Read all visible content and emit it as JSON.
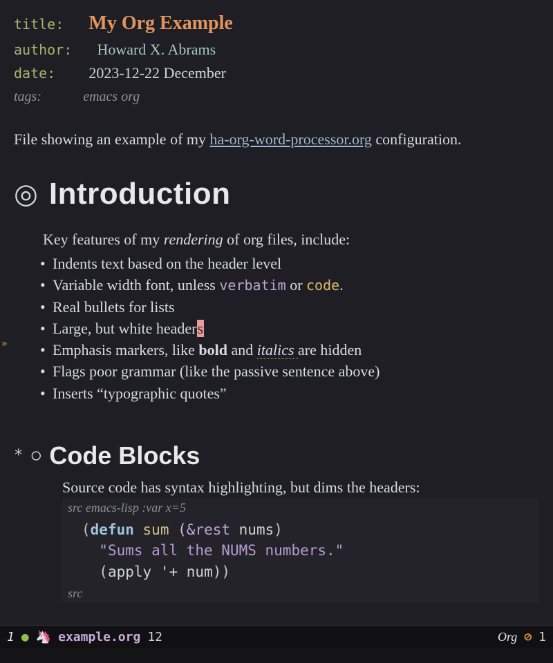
{
  "meta": {
    "title_key": "title:",
    "title_val": "My Org Example",
    "author_key": "author:",
    "author_val": "Howard X. Abrams",
    "date_key": "date:",
    "date_val": "2023-12-22 December",
    "tags_key": "tags:",
    "tags_val": "emacs org"
  },
  "intro_para": {
    "before": "File showing an example of my ",
    "link": "ha-org-word-processor.org",
    "after": " configuration."
  },
  "h1": {
    "bullet": "◎",
    "text": "Introduction"
  },
  "features_lead": {
    "before": "Key features of my ",
    "em": "rendering",
    "after": " of org files, include:"
  },
  "features": {
    "i0": "Indents text based on the header level",
    "i1": {
      "before": "Variable width font, unless ",
      "verbatim": "verbatim",
      "mid": " or ",
      "code": "code",
      "after": "."
    },
    "i2": "Real bullets for lists",
    "i3": {
      "before": "Large, but white header",
      "cursor": "s"
    },
    "i4": {
      "before": "Emphasis markers, like ",
      "bold": "bold",
      "mid": " and ",
      "italic": "italics ",
      "after": "are hidden"
    },
    "i5": "Flags poor grammar (like the passive sentence above)",
    "i6": "Inserts “typographic quotes”"
  },
  "h2": {
    "asterisk": "*",
    "bullet": "○",
    "text": "Code Blocks"
  },
  "src": {
    "lead": "Source code has syntax highlighting, but dims the headers:",
    "header": "src emacs-lisp :var x=5",
    "footer": "src",
    "line1": {
      "paren_open": "(",
      "kw": "defun",
      "sp1": " ",
      "fn": "sum",
      "sp2": " ",
      "paren2": "(",
      "amp": "&rest",
      "sp3": " ",
      "arg": "nums",
      "paren_close": ")"
    },
    "line2": {
      "str": "\"Sums all the NUMS numbers.\""
    },
    "line3": {
      "paren_open": "(",
      "builtin": "apply",
      "sp": " ",
      "quote": "'+",
      "sp2": " ",
      "arg": "num",
      "close": "))"
    }
  },
  "modeline": {
    "win": "1",
    "dot": "●",
    "unicorn": "🦄",
    "file": "example.org",
    "pos": "12",
    "mode": "Org",
    "warn_icon": "⊘",
    "warn_count": "1"
  },
  "fringe": "»"
}
